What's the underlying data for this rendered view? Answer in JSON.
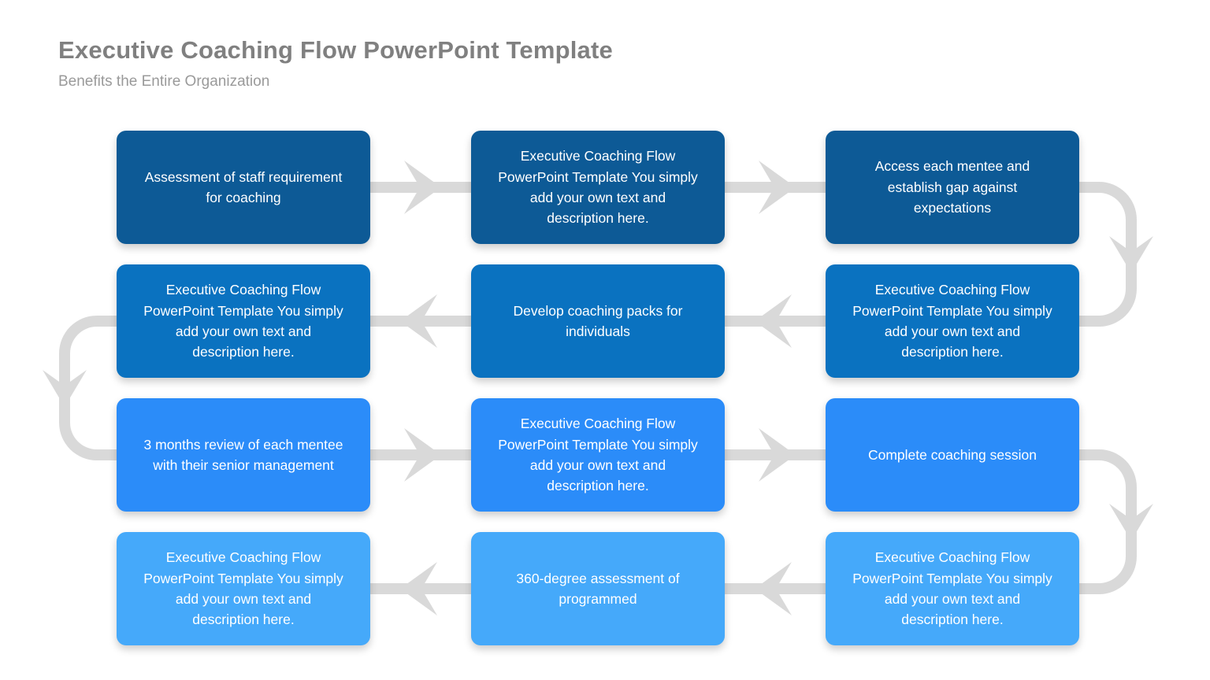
{
  "header": {
    "title": "Executive Coaching Flow PowerPoint Template",
    "subtitle": "Benefits the Entire Organization"
  },
  "theme": {
    "background": "#ffffff",
    "title_color": "#808080",
    "subtitle_color": "#9a9a9a",
    "connector_color": "#d9d9d9",
    "node_text_color": "#ffffff",
    "row_colors": [
      "#0d5a96",
      "#0a72c0",
      "#2b8cf9",
      "#45a9fa"
    ]
  },
  "diagram": {
    "type": "serpentine-process-flow",
    "rows": 4,
    "columns": 3,
    "nodes": [
      {
        "id": "r1c1",
        "row": 0,
        "col": 0,
        "color": "#0d5a96",
        "text": "Assessment of staff requirement\nfor coaching"
      },
      {
        "id": "r1c2",
        "row": 0,
        "col": 1,
        "color": "#0d5a96",
        "text": "Executive Coaching Flow\nPowerPoint Template You simply\nadd your own text and\ndescription here."
      },
      {
        "id": "r1c3",
        "row": 0,
        "col": 2,
        "color": "#0d5a96",
        "text": "Access each mentee and\nestablish gap against\nexpectations"
      },
      {
        "id": "r2c1",
        "row": 1,
        "col": 0,
        "color": "#0a72c0",
        "text": "Executive Coaching Flow\nPowerPoint Template You simply\nadd your own text and\ndescription here."
      },
      {
        "id": "r2c2",
        "row": 1,
        "col": 1,
        "color": "#0a72c0",
        "text": "Develop coaching packs for\nindividuals"
      },
      {
        "id": "r2c3",
        "row": 1,
        "col": 2,
        "color": "#0a72c0",
        "text": "Executive Coaching Flow\nPowerPoint Template You simply\nadd your own text and\ndescription here."
      },
      {
        "id": "r3c1",
        "row": 2,
        "col": 0,
        "color": "#2b8cf9",
        "text": "3 months review of each mentee\nwith their senior management"
      },
      {
        "id": "r3c2",
        "row": 2,
        "col": 1,
        "color": "#2b8cf9",
        "text": "Executive Coaching Flow\nPowerPoint Template You simply\nadd your own text and\ndescription here."
      },
      {
        "id": "r3c3",
        "row": 2,
        "col": 2,
        "color": "#2b8cf9",
        "text": "Complete coaching session"
      },
      {
        "id": "r4c1",
        "row": 3,
        "col": 0,
        "color": "#45a9fa",
        "text": "Executive Coaching Flow\nPowerPoint Template You simply\nadd your own text and\ndescription here."
      },
      {
        "id": "r4c2",
        "row": 3,
        "col": 1,
        "color": "#45a9fa",
        "text": "360-degree assessment of\nprogrammed"
      },
      {
        "id": "r4c3",
        "row": 3,
        "col": 2,
        "color": "#45a9fa",
        "text": "Executive Coaching Flow\nPowerPoint Template You simply\nadd your own text and\ndescription here."
      }
    ],
    "connectors": [
      {
        "id": "a-r1-c1-c2",
        "kind": "straight",
        "direction": "right",
        "from": "r1c1",
        "to": "r1c2"
      },
      {
        "id": "a-r1-c2-c3",
        "kind": "straight",
        "direction": "right",
        "from": "r1c2",
        "to": "r1c3"
      },
      {
        "id": "a-wrap-r1-r2",
        "kind": "curved",
        "direction": "down",
        "side": "right",
        "from": "r1c3",
        "to": "r2c3"
      },
      {
        "id": "a-r2-c3-c2",
        "kind": "straight",
        "direction": "left",
        "from": "r2c3",
        "to": "r2c2"
      },
      {
        "id": "a-r2-c2-c1",
        "kind": "straight",
        "direction": "left",
        "from": "r2c2",
        "to": "r2c1"
      },
      {
        "id": "a-wrap-r2-r3",
        "kind": "curved",
        "direction": "down",
        "side": "left",
        "from": "r2c1",
        "to": "r3c1"
      },
      {
        "id": "a-r3-c1-c2",
        "kind": "straight",
        "direction": "right",
        "from": "r3c1",
        "to": "r3c2"
      },
      {
        "id": "a-r3-c2-c3",
        "kind": "straight",
        "direction": "right",
        "from": "r3c2",
        "to": "r3c3"
      },
      {
        "id": "a-wrap-r3-r4",
        "kind": "curved",
        "direction": "down",
        "side": "right",
        "from": "r3c3",
        "to": "r4c3"
      },
      {
        "id": "a-r4-c3-c2",
        "kind": "straight",
        "direction": "left",
        "from": "r4c3",
        "to": "r4c2"
      },
      {
        "id": "a-r4-c2-c1",
        "kind": "straight",
        "direction": "left",
        "from": "r4c2",
        "to": "r4c1"
      }
    ]
  }
}
